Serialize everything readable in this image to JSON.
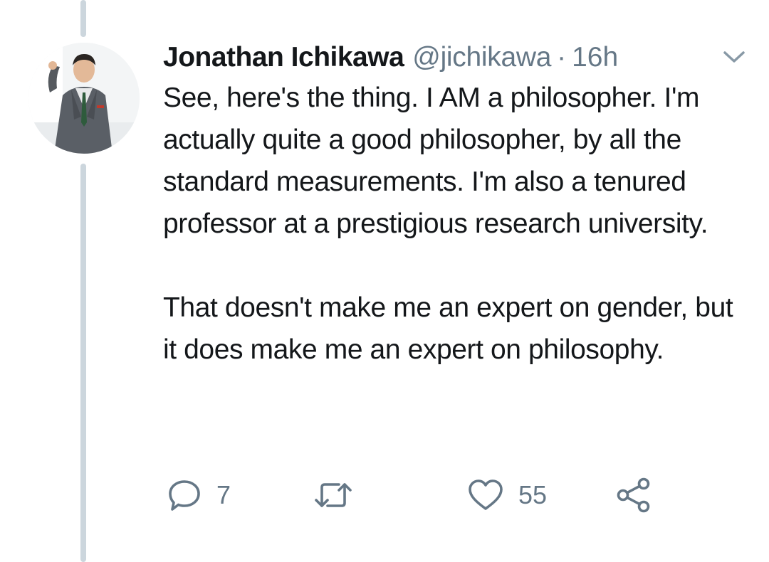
{
  "tweet": {
    "author": {
      "display_name": "Jonathan Ichikawa",
      "handle": "@jichikawa"
    },
    "separator": "·",
    "timestamp": "16h",
    "paragraphs": [
      "See, here's the thing. I AM a philosopher. I'm actually quite a good philosopher, by all the standard measurements. I'm also a tenured professor at a prestigious research university.",
      "That doesn't make me an expert on gender, but it does make me an expert on philosophy."
    ],
    "actions": {
      "reply_count": "7",
      "retweet_count": "",
      "like_count": "55"
    },
    "icons": {
      "reply": "reply-icon",
      "retweet": "retweet-icon",
      "like": "heart-icon",
      "share": "share-icon",
      "menu": "chevron-down-icon"
    }
  },
  "colors": {
    "text_primary": "#14171a",
    "text_secondary": "#657786",
    "thread_line": "#ccd6dd",
    "background": "#ffffff"
  }
}
